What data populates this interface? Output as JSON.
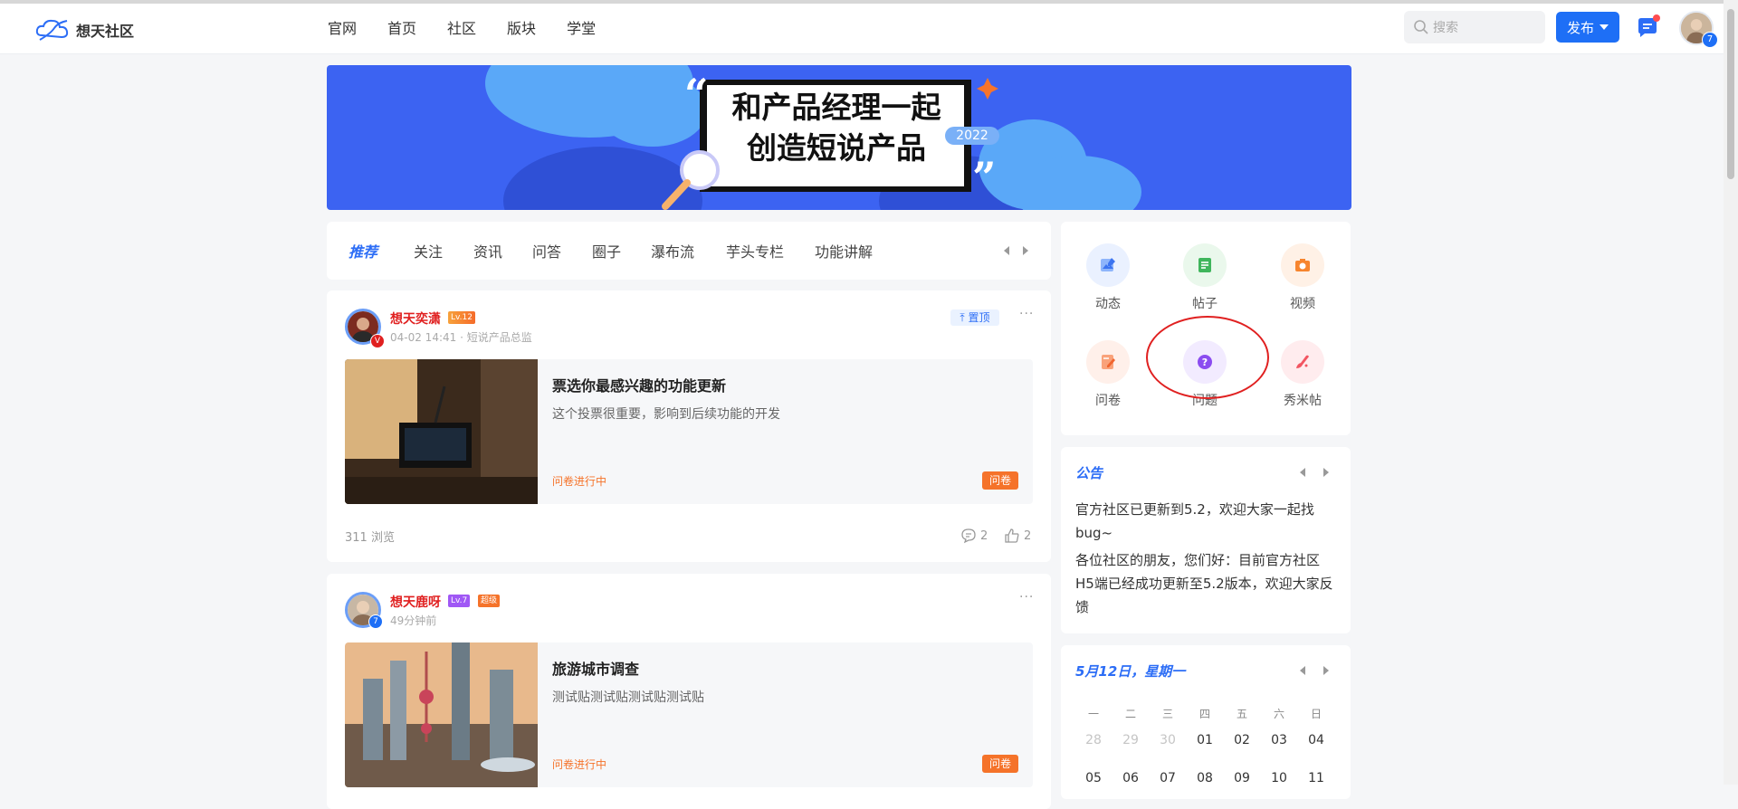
{
  "header": {
    "logo_text": "想天社区",
    "nav": [
      "官网",
      "首页",
      "社区",
      "版块",
      "学堂"
    ],
    "search_placeholder": "搜索",
    "publish_label": "发布",
    "avatar_badge": "7"
  },
  "banner": {
    "line1": "和产品经理一起",
    "line2": "创造短说产品",
    "year": "2022"
  },
  "tabs": [
    "推荐",
    "关注",
    "资讯",
    "问答",
    "圈子",
    "瀑布流",
    "芋头专栏",
    "功能讲解"
  ],
  "posts": [
    {
      "author": "想天奕潇",
      "level": "Lv.12",
      "badge": "V",
      "meta": "04-02 14:41 · 短说产品总监",
      "pin_label": "置顶",
      "more": "···",
      "title": "票选你最感兴趣的功能更新",
      "desc": "这个投票很重要，影响到后续功能的开发",
      "status": "问卷进行中",
      "tag": "问卷",
      "views": "311 浏览",
      "comments": "2",
      "likes": "2"
    },
    {
      "author": "想天鹿呀",
      "level": "Lv.7",
      "extra_badge": "超级",
      "badge": "7",
      "meta": "49分钟前",
      "more": "···",
      "title": "旅游城市调查",
      "desc": "测试贴测试贴测试贴测试贴",
      "status": "问卷进行中",
      "tag": "问卷"
    }
  ],
  "quick_actions": [
    "动态",
    "帖子",
    "视频",
    "问卷",
    "问题",
    "秀米帖"
  ],
  "announcement": {
    "title": "公告",
    "items": [
      "官方社区已更新到5.2，欢迎大家一起找bug~",
      "各位社区的朋友，您们好：目前官方社区H5端已经成功更新至5.2版本，欢迎大家反馈"
    ]
  },
  "calendar": {
    "title": "5月12日，星期一",
    "weekdays": [
      "一",
      "二",
      "三",
      "四",
      "五",
      "六",
      "日"
    ],
    "row1": [
      "28",
      "29",
      "30",
      "01",
      "02",
      "03",
      "04"
    ],
    "row2": [
      "05",
      "06",
      "07",
      "08",
      "09",
      "10",
      "11"
    ]
  },
  "colors": {
    "brand": "#1e6ff6",
    "banner": "#3c63f2",
    "author_red": "#e02020",
    "survey_orange": "#f5732a",
    "highlight_circle": "#e02020"
  }
}
